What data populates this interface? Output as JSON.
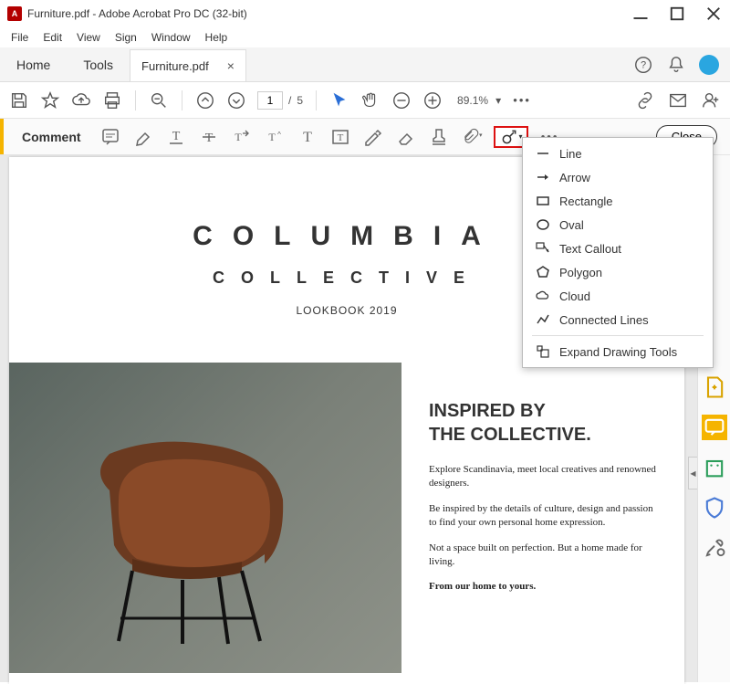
{
  "titlebar": {
    "title": "Furniture.pdf - Adobe Acrobat Pro DC (32-bit)"
  },
  "menubar": {
    "items": [
      "File",
      "Edit",
      "View",
      "Sign",
      "Window",
      "Help"
    ]
  },
  "tabs": {
    "home": "Home",
    "tools": "Tools",
    "document": "Furniture.pdf"
  },
  "toolbar": {
    "page_current": "1",
    "page_sep": "/",
    "page_total": "5",
    "zoom": "89.1%"
  },
  "comment_bar": {
    "label": "Comment",
    "close": "Close"
  },
  "drawing_menu": {
    "items": [
      {
        "icon": "line",
        "label": "Line"
      },
      {
        "icon": "arrow",
        "label": "Arrow"
      },
      {
        "icon": "rectangle",
        "label": "Rectangle"
      },
      {
        "icon": "oval",
        "label": "Oval"
      },
      {
        "icon": "text-callout",
        "label": "Text Callout"
      },
      {
        "icon": "polygon",
        "label": "Polygon"
      },
      {
        "icon": "cloud",
        "label": "Cloud"
      },
      {
        "icon": "connected-lines",
        "label": "Connected Lines"
      }
    ],
    "expand": "Expand Drawing Tools"
  },
  "document": {
    "title": "COLUMBIA",
    "subtitle": "COLLECTIVE",
    "lookbook": "LOOKBOOK 2019",
    "heading1": "INSPIRED BY",
    "heading2": "THE COLLECTIVE.",
    "p1": "Explore Scandinavia, meet local creatives and renowned designers.",
    "p2": "Be inspired by the details of culture, design and passion to find your own personal home expression.",
    "p3": "Not a space built on perfection. But a home made for living.",
    "p4": "From our home to yours."
  }
}
